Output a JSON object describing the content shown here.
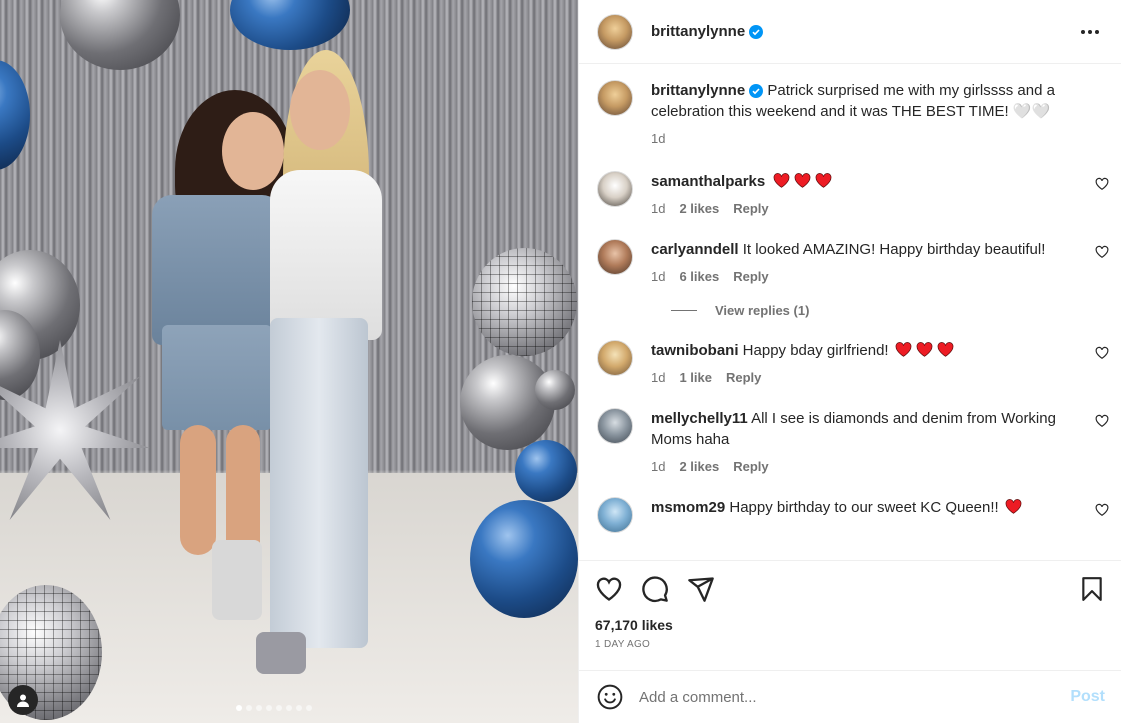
{
  "post": {
    "author": "brittanylynne",
    "verified": true,
    "caption": "Patrick surprised me with my girlssss and a celebration this weekend and it was THE BEST TIME! 🤍🤍",
    "caption_age": "1d",
    "likes_text": "67,170 likes",
    "time_ago": "1 DAY AGO",
    "carousel_count": 8,
    "carousel_active_index": 0
  },
  "comments": [
    {
      "user": "samanthalparks",
      "text": "",
      "hearts": 3,
      "age": "1d",
      "likes": "2 likes",
      "reply": "Reply"
    },
    {
      "user": "carlyanndell",
      "text": "It looked AMAZING! Happy birthday beautiful!",
      "hearts": 0,
      "age": "1d",
      "likes": "6 likes",
      "reply": "Reply",
      "view_replies": "View replies (1)"
    },
    {
      "user": "tawnibobani",
      "text": "Happy bday girlfriend!",
      "hearts": 3,
      "age": "1d",
      "likes": "1 like",
      "reply": "Reply"
    },
    {
      "user": "mellychelly11",
      "text": "All I see is diamonds and denim from Working Moms haha",
      "hearts": 0,
      "age": "1d",
      "likes": "2 likes",
      "reply": "Reply"
    },
    {
      "user": "msmom29",
      "text": "Happy birthday to our sweet KC Queen!!",
      "hearts": 1,
      "age": "",
      "likes": "",
      "reply": ""
    }
  ],
  "add_comment": {
    "placeholder": "Add a comment...",
    "post_label": "Post"
  },
  "icons": [
    "more-icon",
    "verified-icon",
    "heart-icon",
    "comment-icon",
    "share-icon",
    "save-icon",
    "emoji-icon",
    "user-tag-icon"
  ],
  "colors": {
    "verified": "#0095f6",
    "heart_emoji": "#ed1c24",
    "post_disabled": "#b2dffc",
    "meta_text": "#737373"
  }
}
